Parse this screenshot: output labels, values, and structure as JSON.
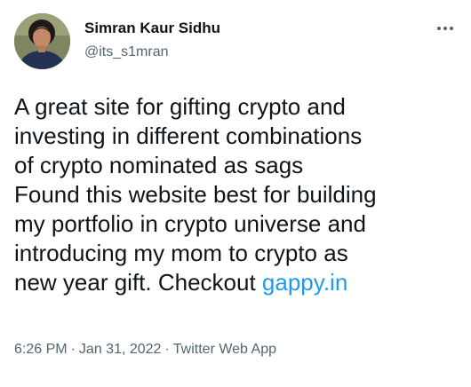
{
  "author": {
    "name": "Simran Kaur Sidhu",
    "handle": "@its_s1mran",
    "avatar_icon": "user-avatar-photo"
  },
  "tweet": {
    "text_lines": [
      "A great site for gifting crypto and",
      "investing in different combinations",
      "of crypto nominated as sags",
      "Found this website best for building",
      "my portfolio in crypto universe and",
      "introducing my mom to crypto as",
      "new year gift. Checkout "
    ],
    "link_text": "gappy.in"
  },
  "meta": {
    "time": "6:26 PM",
    "separator": "·",
    "date": "Jan 31, 2022",
    "source": "Twitter Web App"
  },
  "more_icon": "more-horizontal-icon",
  "colors": {
    "text": "#0f1419",
    "secondary": "#536471",
    "link": "#1d9bf0",
    "background": "#ffffff"
  }
}
